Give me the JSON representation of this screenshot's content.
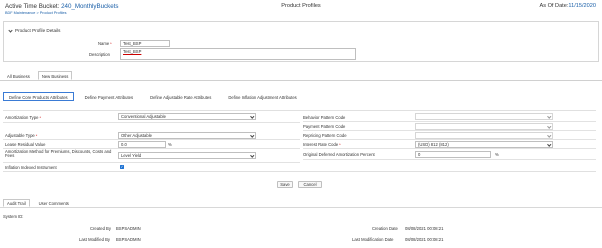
{
  "header": {
    "active_label": "Active Time Bucket: ",
    "active_value": "240_MonthlyBuckets",
    "breadcrumb": "BDF Maintenance > Product Profiles",
    "page_title": "Product Profiles",
    "as_of_label": "As Of Date:",
    "as_of_value": "11/15/2020"
  },
  "details": {
    "section_title": "Product Profile Details",
    "name_label": "Name",
    "name_value": "Test_BSP",
    "description_label": "Description",
    "description_value": "Test_BSP"
  },
  "business_tabs": [
    "All Business",
    "New Business"
  ],
  "attribute_tabs": [
    "Define Core Products Attributes",
    "Define Payment Attributes",
    "Define Adjustable Rate Attributes",
    "Define Inflation Adjustment Attributes"
  ],
  "left_fields": {
    "amortization_type_label": "Amortization Type",
    "amortization_type_value": "Conventional Adjustable",
    "adjustable_type_label": "Adjustable Type",
    "adjustable_type_value": "Other Adjustable",
    "lease_residual_label": "Lease Residual Value",
    "lease_residual_value": "0.0",
    "lease_residual_unit": "%",
    "amort_method_label": "Amortization Method for Premiums, Discounts, Costs and Fees",
    "amort_method_value": "Level Yield",
    "inflation_label": "Inflation Indexed Instrument"
  },
  "right_fields": {
    "behavior_label": "Behavior Pattern Code",
    "payment_label": "Payment Pattern Code",
    "repricing_label": "Repricing Pattern Code",
    "interest_label": "Interest Rate Code",
    "interest_value": "(USD) 812 (812)",
    "orig_deferred_label": "Original Deferred Amortization Percent",
    "orig_deferred_value": "0",
    "orig_deferred_unit": "%"
  },
  "buttons": {
    "save": "Save",
    "cancel": "Cancel"
  },
  "audit_tabs": [
    "Audit Trail",
    "User Comments"
  ],
  "audit": {
    "system_id_label": "System ID:",
    "created_by_label": "Created By",
    "created_by_value": "BSPSADMIN",
    "creation_date_label": "Creation Date",
    "creation_date_value": "08/08/2021 00:08:21",
    "last_modified_by_label": "Last Modified By",
    "last_modified_by_value": "BSPSADMIN",
    "last_modification_date_label": "Last Modification Date",
    "last_modification_date_value": "08/08/2021 00:08:21"
  },
  "colors": {
    "link_blue": "#1a5fa8",
    "required_red": "#cc0000",
    "checkbox_blue": "#1f73d3"
  }
}
